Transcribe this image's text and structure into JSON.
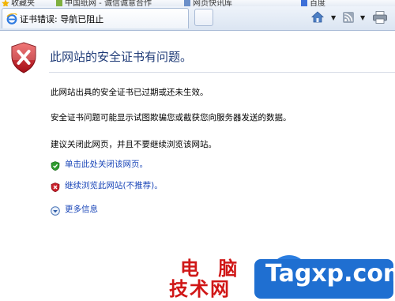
{
  "favorites_bar": {
    "items": [
      "收藏夹",
      "中国纸网 - 诚信诚意合作",
      "网页快讯库",
      "百度"
    ]
  },
  "tab": {
    "title": "证书错误: 导航已阻止"
  },
  "command_bar": {
    "icons": [
      "home-icon",
      "feeds-icon",
      "print-icon"
    ]
  },
  "error_page": {
    "title": "此网站的安全证书有问题。",
    "paragraph_1": "此网站出具的安全证书已过期或还未生效。",
    "paragraph_2": "安全证书问题可能显示试图欺骗您或截获您向服务器发送的数据。",
    "paragraph_3": "建议关闭此网页，并且不要继续浏览该网站。",
    "link_close": "单击此处关闭该网页。",
    "link_continue": "继续浏览此网站(不推荐)。",
    "more_info": "更多信息"
  },
  "watermark": {
    "cn_line_1": "电 脑",
    "cn_line_2": "技术网",
    "en": "Tagxp.com"
  },
  "colors": {
    "title_blue": "#1f3b77",
    "link_blue": "#1a46b8",
    "shield_red": "#c8202a",
    "safe_green": "#2f9a2f",
    "watermark_red": "#d01717",
    "watermark_badge": "#1f6fd1"
  }
}
